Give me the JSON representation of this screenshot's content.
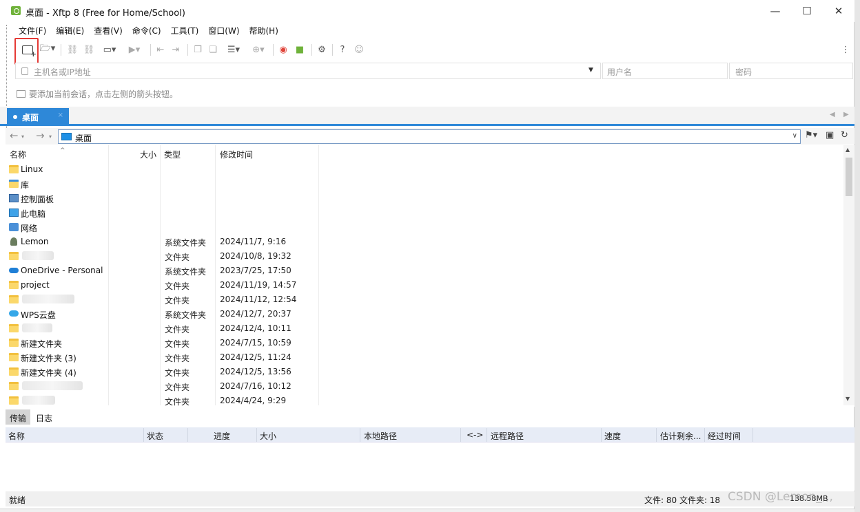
{
  "window": {
    "title": "桌面 - Xftp 8 (Free for Home/School)",
    "minimize": "—",
    "maximize": "☐",
    "close": "✕"
  },
  "menu": [
    "文件(F)",
    "编辑(E)",
    "查看(V)",
    "命令(C)",
    "工具(T)",
    "窗口(W)",
    "帮助(H)"
  ],
  "connect": {
    "host_placeholder": "主机名或IP地址",
    "user_placeholder": "用户名",
    "password_placeholder": "密码",
    "hint": "要添加当前会话，点击左侧的箭头按钮。"
  },
  "tab": {
    "label": "桌面",
    "close": "×"
  },
  "path": {
    "value": "桌面"
  },
  "columns": {
    "name": "名称",
    "size": "大小",
    "type": "类型",
    "modified": "修改时间"
  },
  "files": [
    {
      "name": "Linux",
      "type": "",
      "modified": "",
      "icon": "folder"
    },
    {
      "name": "库",
      "type": "",
      "modified": "",
      "icon": "library"
    },
    {
      "name": "控制面板",
      "type": "",
      "modified": "",
      "icon": "control-panel"
    },
    {
      "name": "此电脑",
      "type": "",
      "modified": "",
      "icon": "computer"
    },
    {
      "name": "网络",
      "type": "",
      "modified": "",
      "icon": "network"
    },
    {
      "name": "Lemon",
      "type": "系统文件夹",
      "modified": "2024/11/7, 9:16",
      "icon": "user"
    },
    {
      "name": "",
      "type": "文件夹",
      "modified": "2024/10/8, 19:32",
      "icon": "folder"
    },
    {
      "name": "OneDrive - Personal",
      "type": "系统文件夹",
      "modified": "2023/7/25, 17:50",
      "icon": "onedrive"
    },
    {
      "name": "project",
      "type": "文件夹",
      "modified": "2024/11/19, 14:57",
      "icon": "folder"
    },
    {
      "name": "",
      "type": "文件夹",
      "modified": "2024/11/12, 12:54",
      "icon": "folder"
    },
    {
      "name": "WPS云盘",
      "type": "系统文件夹",
      "modified": "2024/12/7, 20:37",
      "icon": "cloud"
    },
    {
      "name": "",
      "type": "文件夹",
      "modified": "2024/12/4, 10:11",
      "icon": "folder"
    },
    {
      "name": "新建文件夹",
      "type": "文件夹",
      "modified": "2024/7/15, 10:59",
      "icon": "folder"
    },
    {
      "name": "新建文件夹 (3)",
      "type": "文件夹",
      "modified": "2024/12/5, 11:24",
      "icon": "folder"
    },
    {
      "name": "新建文件夹 (4)",
      "type": "文件夹",
      "modified": "2024/12/5, 13:56",
      "icon": "folder"
    },
    {
      "name": "",
      "type": "文件夹",
      "modified": "2024/7/16, 10:12",
      "icon": "folder"
    },
    {
      "name": "",
      "type": "文件夹",
      "modified": "2024/4/24, 9:29",
      "icon": "folder"
    }
  ],
  "transfer": {
    "tabs": [
      "传输",
      "日志"
    ],
    "columns": [
      "名称",
      "状态",
      "进度",
      "大小",
      "本地路径",
      "<->",
      "远程路径",
      "速度",
      "估计剩余...",
      "经过时间"
    ]
  },
  "status": {
    "left": "就绪",
    "counts": "文件: 80  文件夹: 18",
    "size": "138.58MB"
  },
  "watermark": "CSDN @Lemon_,,,"
}
